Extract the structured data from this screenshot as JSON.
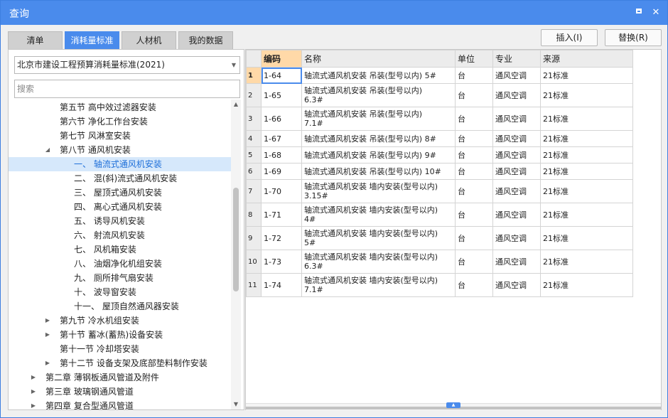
{
  "window": {
    "title": "查询"
  },
  "tabs": [
    {
      "label": "清单",
      "active": false
    },
    {
      "label": "消耗量标准",
      "active": true
    },
    {
      "label": "人材机",
      "active": false
    },
    {
      "label": "我的数据",
      "active": false
    }
  ],
  "buttons": {
    "insert": "插入(I)",
    "replace": "替换(R)"
  },
  "standard_select": {
    "value": "北京市建设工程预算消耗量标准(2021)"
  },
  "search": {
    "placeholder": "搜索"
  },
  "tree": [
    {
      "label": "第五节 高中效过滤器安装",
      "level": 2,
      "expander": ""
    },
    {
      "label": "第六节 净化工作台安装",
      "level": 2,
      "expander": ""
    },
    {
      "label": "第七节 风淋室安装",
      "level": 2,
      "expander": ""
    },
    {
      "label": "第八节 通风机安装",
      "level": 2,
      "expander": "◢"
    },
    {
      "label": "一、  轴流式通风机安装",
      "level": 3,
      "expander": "",
      "selected": true
    },
    {
      "label": "二、  混(斜)流式通风机安装",
      "level": 3,
      "expander": ""
    },
    {
      "label": "三、  屋顶式通风机安装",
      "level": 3,
      "expander": ""
    },
    {
      "label": "四、  离心式通风机安装",
      "level": 3,
      "expander": ""
    },
    {
      "label": "五、  诱导风机安装",
      "level": 3,
      "expander": ""
    },
    {
      "label": "六、  射流风机安装",
      "level": 3,
      "expander": ""
    },
    {
      "label": "七、  风机箱安装",
      "level": 3,
      "expander": ""
    },
    {
      "label": "八、  油烟净化机组安装",
      "level": 3,
      "expander": ""
    },
    {
      "label": "九、  厕所排气扇安装",
      "level": 3,
      "expander": ""
    },
    {
      "label": "十、  波导窗安装",
      "level": 3,
      "expander": ""
    },
    {
      "label": "十一、  屋顶自然通风器安装",
      "level": 3,
      "expander": ""
    },
    {
      "label": "第九节 冷水机组安装",
      "level": 2,
      "expander": "▶"
    },
    {
      "label": "第十节 蓄冰(蓄热)设备安装",
      "level": 2,
      "expander": "▶"
    },
    {
      "label": "第十一节 冷却塔安装",
      "level": 2,
      "expander": ""
    },
    {
      "label": "第十二节 设备支架及底部垫料制作安装",
      "level": 2,
      "expander": "▶"
    },
    {
      "label": "第二章 薄钢板通风管道及附件",
      "level": 1,
      "expander": "▶"
    },
    {
      "label": "第三章 玻璃钢通风管道",
      "level": 1,
      "expander": "▶"
    },
    {
      "label": "第四章 复合型通风管道",
      "level": 1,
      "expander": "▶"
    }
  ],
  "table": {
    "headers": {
      "code": "编码",
      "name": "名称",
      "unit": "单位",
      "specialty": "专业",
      "source": "来源"
    },
    "rows": [
      {
        "no": "1",
        "code": "1-64",
        "name": "轴流式通风机安装 吊装(型号以内) 5#",
        "unit": "台",
        "specialty": "通风空调",
        "source": "21标准",
        "lines": 1
      },
      {
        "no": "2",
        "code": "1-65",
        "name": "轴流式通风机安装 吊装(型号以内)\n6.3#",
        "unit": "台",
        "specialty": "通风空调",
        "source": "21标准",
        "lines": 2
      },
      {
        "no": "3",
        "code": "1-66",
        "name": "轴流式通风机安装 吊装(型号以内)\n7.1#",
        "unit": "台",
        "specialty": "通风空调",
        "source": "21标准",
        "lines": 2
      },
      {
        "no": "4",
        "code": "1-67",
        "name": "轴流式通风机安装 吊装(型号以内) 8#",
        "unit": "台",
        "specialty": "通风空调",
        "source": "21标准",
        "lines": 1
      },
      {
        "no": "5",
        "code": "1-68",
        "name": "轴流式通风机安装 吊装(型号以内) 9#",
        "unit": "台",
        "specialty": "通风空调",
        "source": "21标准",
        "lines": 1
      },
      {
        "no": "6",
        "code": "1-69",
        "name": "轴流式通风机安装 吊装(型号以内) 10#",
        "unit": "台",
        "specialty": "通风空调",
        "source": "21标准",
        "lines": 1
      },
      {
        "no": "7",
        "code": "1-70",
        "name": "轴流式通风机安装 墙内安装(型号以内)\n3.15#",
        "unit": "台",
        "specialty": "通风空调",
        "source": "21标准",
        "lines": 2
      },
      {
        "no": "8",
        "code": "1-71",
        "name": "轴流式通风机安装 墙内安装(型号以内)\n4#",
        "unit": "台",
        "specialty": "通风空调",
        "source": "21标准",
        "lines": 2
      },
      {
        "no": "9",
        "code": "1-72",
        "name": "轴流式通风机安装 墙内安装(型号以内)\n5#",
        "unit": "台",
        "specialty": "通风空调",
        "source": "21标准",
        "lines": 2
      },
      {
        "no": "10",
        "code": "1-73",
        "name": "轴流式通风机安装 墙内安装(型号以内)\n6.3#",
        "unit": "台",
        "specialty": "通风空调",
        "source": "21标准",
        "lines": 2
      },
      {
        "no": "11",
        "code": "1-74",
        "name": "轴流式通风机安装 墙内安装(型号以内)\n7.1#",
        "unit": "台",
        "specialty": "通风空调",
        "source": "21标准",
        "lines": 2
      }
    ]
  },
  "colors": {
    "accent": "#4a8bec",
    "header_highlight": "#ffd9a8",
    "selected_row": "#d6e8fb"
  }
}
